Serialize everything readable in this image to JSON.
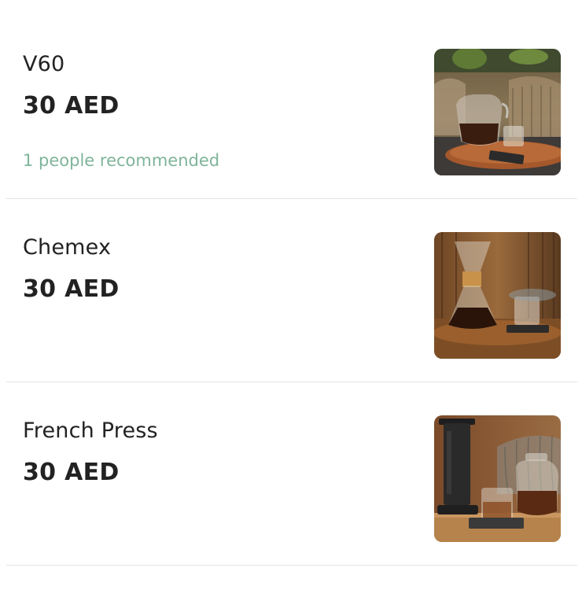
{
  "menu": {
    "items": [
      {
        "name": "V60",
        "price": "30 AED",
        "recommendation": "1 people recommended",
        "photo_icon": "pour-over-coffee-photo"
      },
      {
        "name": "Chemex",
        "price": "30 AED",
        "photo_icon": "chemex-coffee-photo"
      },
      {
        "name": "French Press",
        "price": "30 AED",
        "photo_icon": "aeropress-coffee-photo"
      }
    ]
  },
  "colors": {
    "text": "#222222",
    "recommendation": "#7fb49a",
    "divider": "#e3e3e3"
  }
}
